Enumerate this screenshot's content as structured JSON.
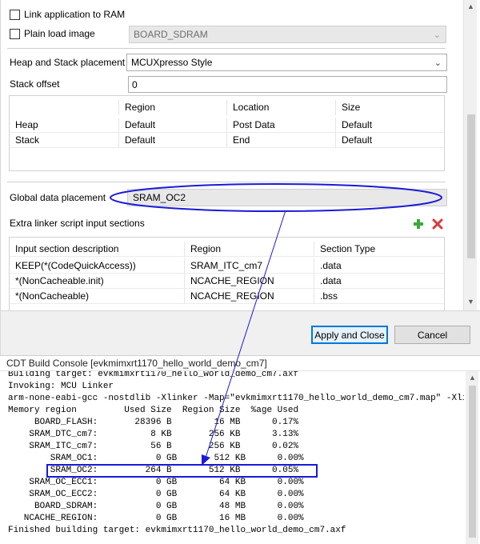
{
  "props": {
    "link_app_ram_label": "Link application to RAM",
    "link_app_ram_checked": false,
    "plain_load_label": "Plain load image",
    "plain_load_checked": false,
    "plain_load_target": "BOARD_SDRAM",
    "heap_stack_label": "Heap and Stack placement",
    "heap_stack_value": "MCUXpresso Style",
    "stack_offset_label": "Stack offset",
    "stack_offset_value": "0",
    "heapstack_table": {
      "headers": [
        "",
        "Region",
        "Location",
        "Size"
      ],
      "rows": [
        [
          "Heap",
          "Default",
          "Post Data",
          "Default"
        ],
        [
          "Stack",
          "Default",
          "End",
          "Default"
        ]
      ]
    },
    "global_data_label": "Global data placement",
    "global_data_value": "SRAM_OC2",
    "extra_sections_label": "Extra linker script input sections",
    "add_icon": "plus-icon",
    "remove_icon": "delete-x-icon",
    "sections_table": {
      "headers": [
        "Input section description",
        "Region",
        "Section Type"
      ],
      "rows": [
        [
          "KEEP(*(CodeQuickAccess))",
          "SRAM_ITC_cm7",
          ".data"
        ],
        [
          "*(NonCacheable.init)",
          "NCACHE_REGION",
          ".data"
        ],
        [
          "*(NonCacheable)",
          "NCACHE_REGION",
          ".bss"
        ]
      ]
    }
  },
  "buttons": {
    "apply_close": "Apply and Close",
    "cancel": "Cancel"
  },
  "console": {
    "title": "CDT Build Console [evkmimxrt1170_hello_world_demo_cm7]",
    "lines": [
      "Building target: evkmimxrt1170_hello_world_demo_cm7.axf",
      "Invoking: MCU Linker",
      "arm-none-eabi-gcc -nostdlib -Xlinker -Map=\"evkmimxrt1170_hello_world_demo_cm7.map\" -Xli",
      "Memory region         Used Size  Region Size  %age Used",
      "     BOARD_FLASH:       28396 B        16 MB      0.17%",
      "    SRAM_DTC_cm7:          8 KB       256 KB      3.13%",
      "    SRAM_ITC_cm7:          56 B       256 KB      0.02%",
      "        SRAM_OC1:           0 GB       512 KB      0.00%",
      "        SRAM_OC2:         264 B       512 KB      0.05%",
      "    SRAM_OC_ECC1:           0 GB        64 KB      0.00%",
      "    SRAM_OC_ECC2:           0 GB        64 KB      0.00%",
      "     BOARD_SDRAM:           0 GB        48 MB      0.00%",
      "   NCACHE_REGION:           0 GB        16 MB      0.00%",
      "Finished building target: evkmimxrt1170_hello_world_demo_cm7.axf"
    ]
  },
  "colors": {
    "annotation": "#1a1ad8",
    "plus": "#3aa93a",
    "delete": "#d83b3b",
    "primary_button_border": "#0078d7"
  }
}
